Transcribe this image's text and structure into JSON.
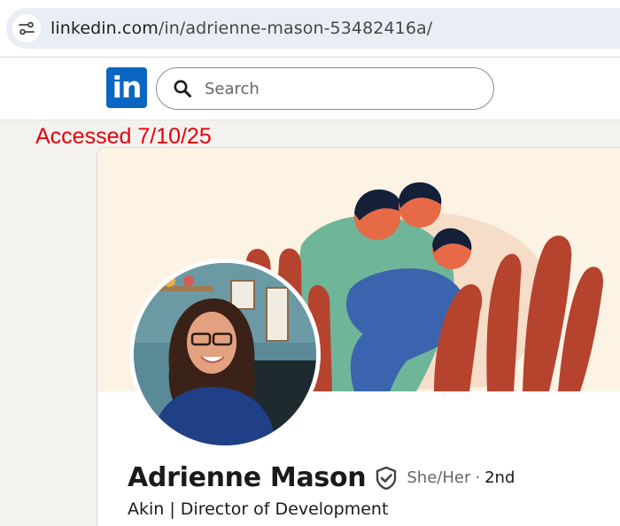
{
  "browser": {
    "url_host": "linkedin.com",
    "url_path": "/in/adrienne-mason-53482416a/",
    "site_info_icon": "tune-icon"
  },
  "header": {
    "logo_text": "in",
    "search": {
      "placeholder": "Search",
      "icon": "search-icon"
    }
  },
  "annotation": {
    "text": "Accessed 7/10/25",
    "color": "#e8000b"
  },
  "profile": {
    "name": "Adrienne Mason",
    "verified_icon": "verified-shield-icon",
    "pronouns": "She/Her",
    "separator": "·",
    "connection_degree": "2nd",
    "headline": "Akin | Director of Development"
  },
  "colors": {
    "linkedin_blue": "#0a66c2",
    "cover_background": "#fcf3e4",
    "page_background": "#f3f2ef"
  }
}
